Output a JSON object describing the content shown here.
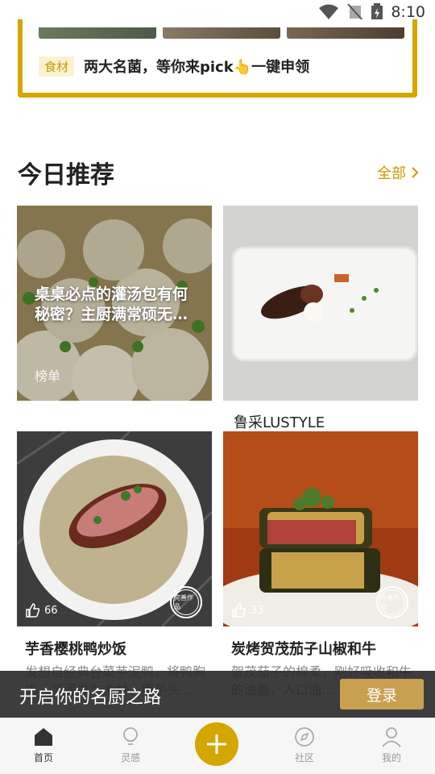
{
  "status_bar": {
    "time": "8:10"
  },
  "promo": {
    "tag": "食材",
    "text": "两大名菌，等你来pick👆一键申领"
  },
  "section": {
    "title": "今日推荐",
    "see_all": "全部"
  },
  "cards": [
    {
      "overlay": "桌桌必点的灌汤包有何秘密？主厨满常硕无…",
      "tag": "榜单"
    },
    {
      "caption": "鲁采LUSTYLE"
    },
    {
      "likes": "66",
      "title": "芋香樱桃鸭炒饭",
      "desc": "发想自经典台菜芋泥鸭，将鸭胸肉、芋泥做为主材，用芋头…",
      "badge": "完善作品"
    },
    {
      "likes": "33",
      "title": "炭烤贺茂茄子山椒和牛",
      "desc": "贺茂茄子的棉柔，刚好吸收和牛的油脂，入口油…",
      "badge": "完善作品"
    }
  ],
  "login_banner": {
    "message": "开启你的名厨之路",
    "button": "登录"
  },
  "tabbar": {
    "items": [
      {
        "label": "首页",
        "icon": "home-icon"
      },
      {
        "label": "灵感",
        "icon": "lightbulb-icon"
      },
      {
        "label": "",
        "icon": "plus-icon"
      },
      {
        "label": "社区",
        "icon": "compass-icon"
      },
      {
        "label": "我的",
        "icon": "profile-icon"
      }
    ]
  },
  "colors": {
    "accent": "#d4a600",
    "login_button": "#c9a050"
  }
}
